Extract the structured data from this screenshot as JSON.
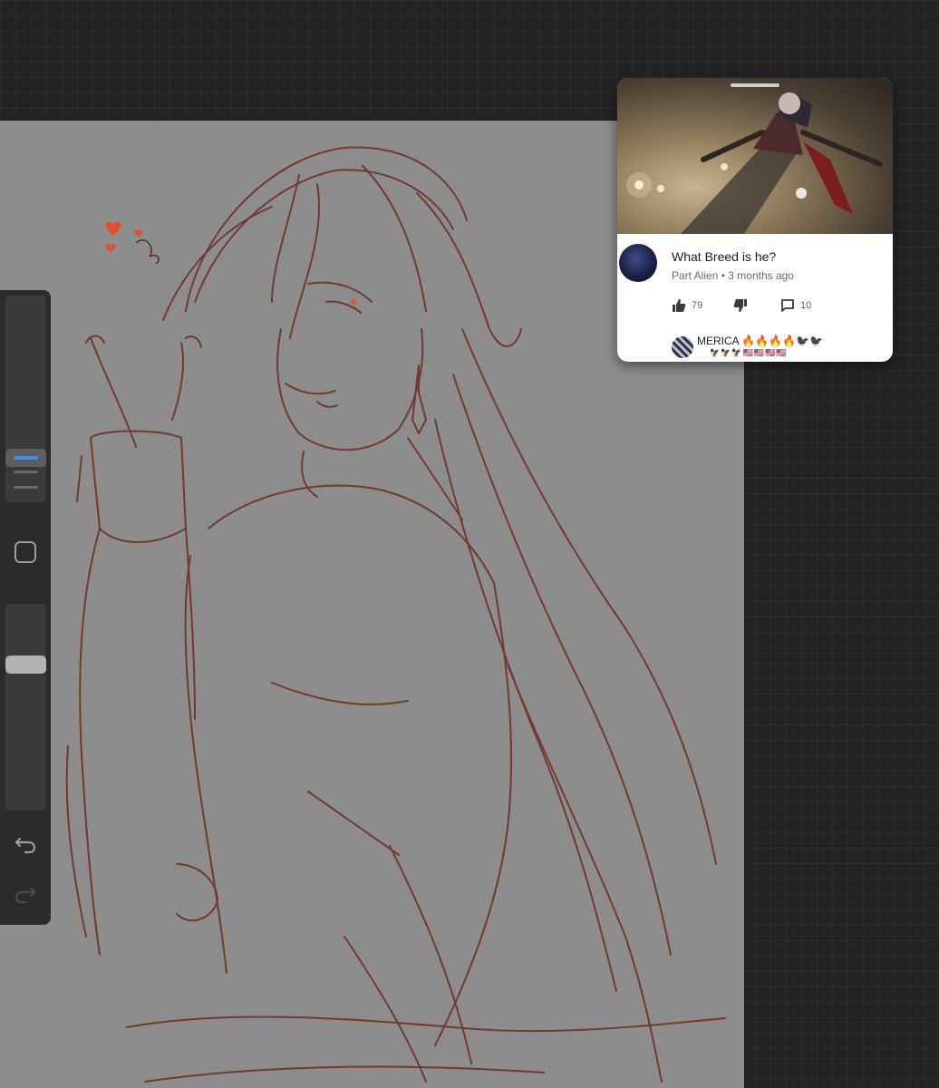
{
  "video_popup": {
    "title": "What Breed is he?",
    "channel": "Part Alien",
    "separator": "•",
    "age": "3 months ago",
    "likes": "79",
    "replies": "10",
    "reply_preview": {
      "name": "MERICA 🔥🔥🔥🔥🐦‍⬛🐦‍⬛",
      "flags": "🦅🦅🦅🇺🇸🇺🇸🇺🇸🇺🇸"
    }
  },
  "icons": {
    "modify": "square-icon",
    "undo": "undo-icon",
    "redo": "redo-icon",
    "like": "thumbs-up-icon",
    "dislike": "thumbs-down-icon",
    "comment": "comment-icon"
  },
  "colors": {
    "canvas": "#8d8d8d",
    "sketch_stroke": "#6e3224",
    "accent": "#3b8ff0",
    "workspace": "#232323",
    "hearts": "#e0522f"
  },
  "brush_size_level": 0.26,
  "opacity_level": 0.73
}
